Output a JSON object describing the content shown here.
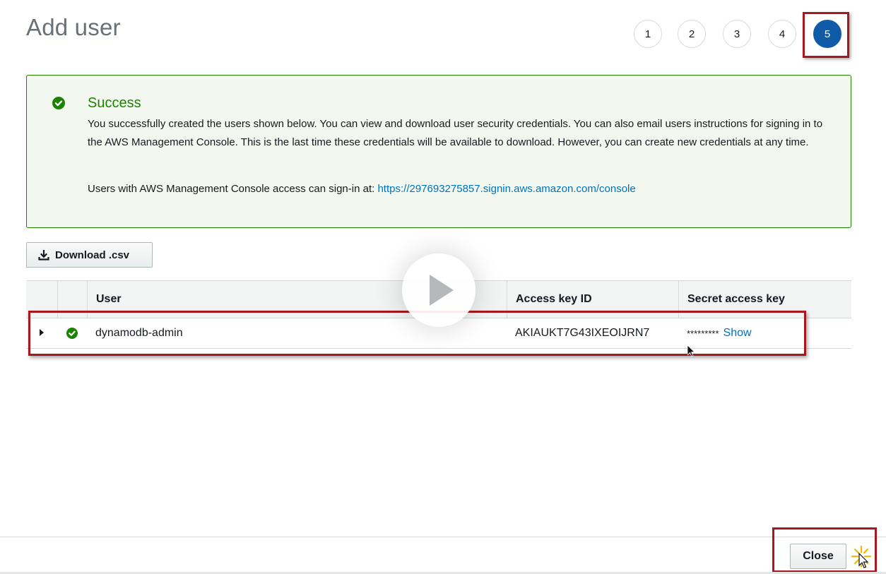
{
  "page": {
    "title": "Add user"
  },
  "steps": [
    {
      "label": "1",
      "active": false
    },
    {
      "label": "2",
      "active": false
    },
    {
      "label": "3",
      "active": false
    },
    {
      "label": "4",
      "active": false
    },
    {
      "label": "5",
      "active": true
    }
  ],
  "alert": {
    "title": "Success",
    "body": "You successfully created the users shown below. You can view and download user security credentials. You can also email users instructions for signing in to the AWS Management Console. This is the last time these credentials will be available to download. However, you can create new credentials at any time.",
    "signin_prefix": "Users with AWS Management Console access can sign-in at: ",
    "signin_url": "https://297693275857.signin.aws.amazon.com/console"
  },
  "actions": {
    "download_label": "Download .csv"
  },
  "table": {
    "columns": [
      "User",
      "Access key ID",
      "Secret access key"
    ],
    "rows": [
      {
        "user": "dynamodb-admin",
        "access_key_id": "AKIAUKT7G43IXEOIJRN7",
        "secret_masked": "*********",
        "show_label": "Show"
      }
    ]
  },
  "footer": {
    "close_label": "Close"
  },
  "colors": {
    "accent": "#0f5ba7",
    "success": "#1d8102",
    "link": "#0073bb",
    "highlight": "#a5181d"
  }
}
